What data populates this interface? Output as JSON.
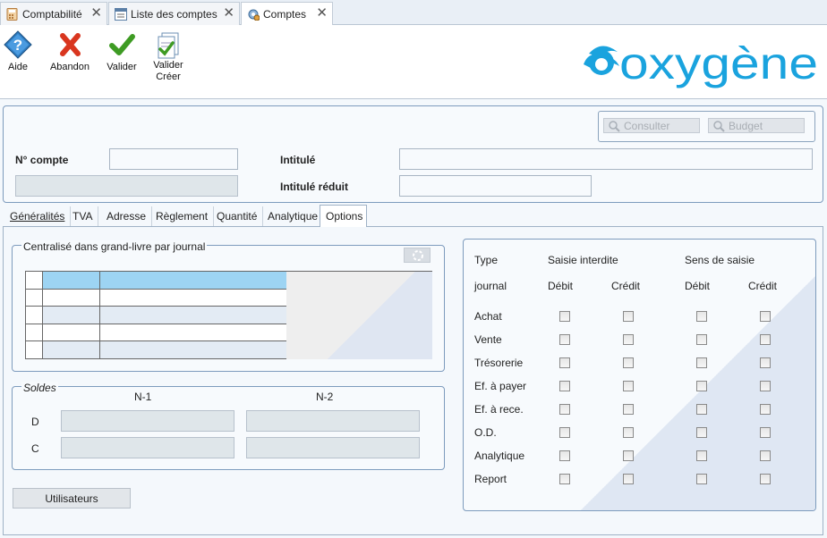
{
  "window_tabs": [
    {
      "label": "Comptabilité",
      "active": false
    },
    {
      "label": "Liste des comptes",
      "active": false
    },
    {
      "label": "Comptes",
      "active": true
    }
  ],
  "toolbar": {
    "aide": "Aide",
    "abandon": "Abandon",
    "valider": "Valider",
    "valider_creer_1": "Valider",
    "valider_creer_2": "Créer"
  },
  "brand": {
    "logo_text": "oxygène",
    "color": "#1aa3de"
  },
  "header": {
    "consulter": "Consulter",
    "budget": "Budget",
    "no_compte_label": "N° compte",
    "no_compte_value": "",
    "intitule_label": "Intitulé",
    "intitule_value": "",
    "intitule_reduit_label": "Intitulé réduit",
    "intitule_reduit_value": ""
  },
  "tabs": [
    "Généralités",
    "TVA",
    "Adresse",
    "Règlement",
    "Quantité",
    "Analytique",
    "Options"
  ],
  "active_tab": "Options",
  "centralise": {
    "legend": "Centralisé dans grand-livre par journal",
    "rows": 5
  },
  "soldes": {
    "legend": "Soldes",
    "col1": "N-1",
    "col2": "N-2",
    "row_d": "D",
    "row_c": "C"
  },
  "utilisateurs_button": "Utilisateurs",
  "saisie": {
    "header_type": "Type",
    "header_journal": "journal",
    "header_interdite": "Saisie interdite",
    "header_sens": "Sens de saisie",
    "debit": "Débit",
    "credit": "Crédit",
    "rows": [
      "Achat",
      "Vente",
      "Trésorerie",
      "Ef. à payer",
      "Ef.  à rece.",
      "O.D.",
      "Analytique",
      "Report"
    ]
  }
}
